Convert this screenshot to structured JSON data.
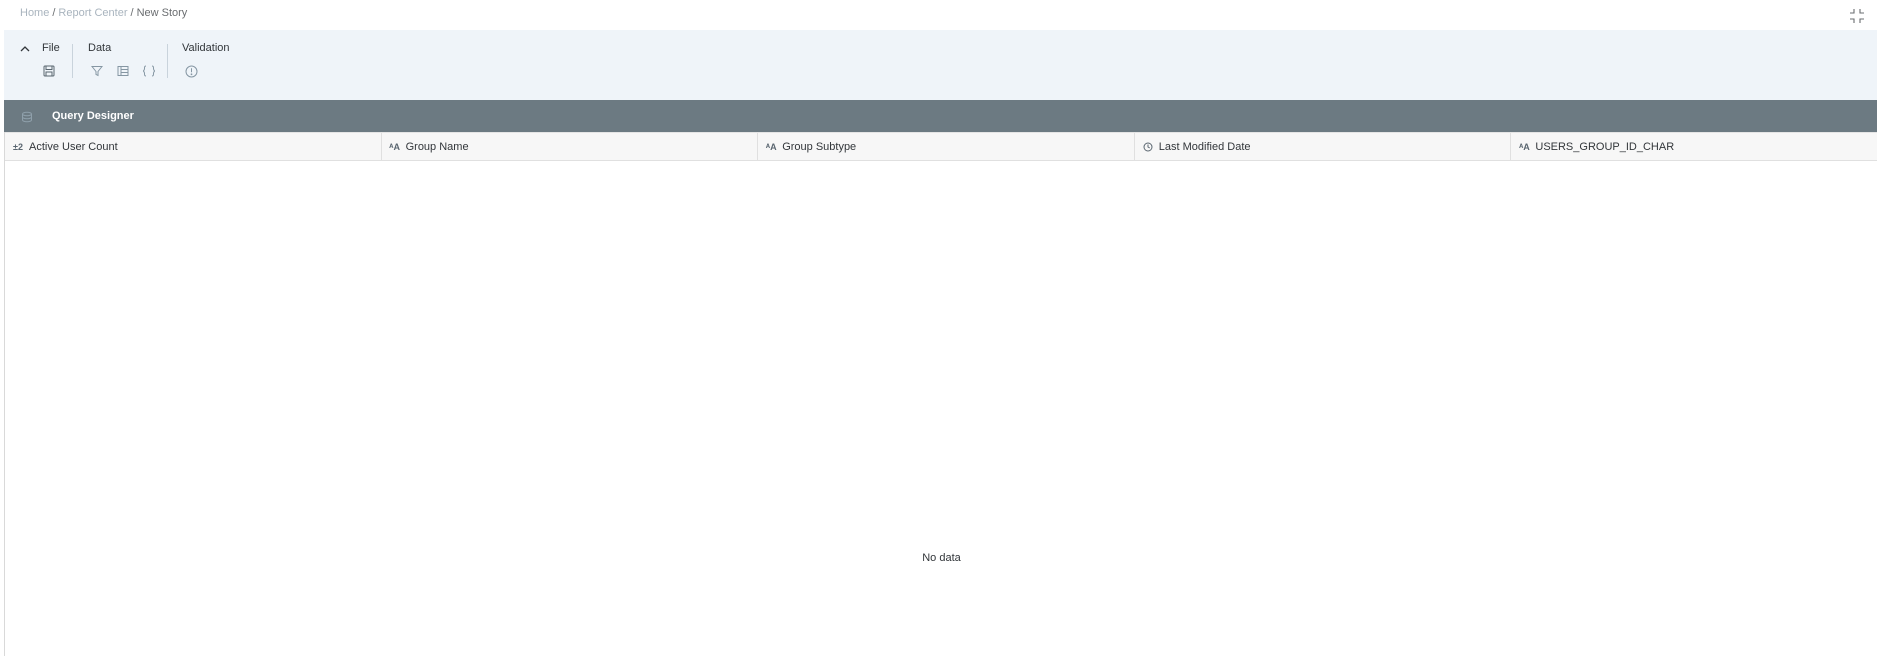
{
  "breadcrumb": {
    "home": "Home",
    "report_center": "Report Center",
    "current": "New Story",
    "separator": "/"
  },
  "toolbar": {
    "file_label": "File",
    "data_label": "Data",
    "validation_label": "Validation"
  },
  "panel": {
    "title": "Query Designer"
  },
  "columns": [
    {
      "label": "Active User Count",
      "type_icon": "number-type-icon",
      "type_glyph": "±2"
    },
    {
      "label": "Group Name",
      "type_icon": "text-type-icon",
      "type_glyph": "ᴬA"
    },
    {
      "label": "Group Subtype",
      "type_icon": "text-type-icon",
      "type_glyph": "ᴬA"
    },
    {
      "label": "Last Modified Date",
      "type_icon": "date-time-type-icon",
      "type_glyph": ""
    },
    {
      "label": "USERS_GROUP_ID_CHAR",
      "type_icon": "text-type-icon",
      "type_glyph": "ᴬA"
    }
  ],
  "empty_state": {
    "message": "No data"
  },
  "colors": {
    "toolbar_bg": "#eff4f9",
    "panel_header_bg": "#6c7a82",
    "icon_gray": "#8596a3"
  }
}
